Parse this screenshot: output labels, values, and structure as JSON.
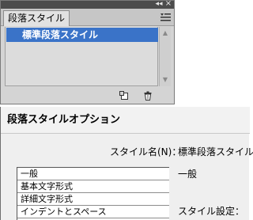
{
  "panel": {
    "tab_label": "段落スタイル",
    "selected_style": "標準段落スタイル"
  },
  "dialog": {
    "title": "段落スタイルオプション",
    "style_name_label": "スタイル名(N)：",
    "style_name_value": "標準段落スタイル",
    "section_heading": "一般",
    "settings_label": "スタイル設定：",
    "categories": [
      {
        "label": "一般"
      },
      {
        "label": "基本文字形式"
      },
      {
        "label": "詳細文字形式"
      },
      {
        "label": "インデントとスペース"
      }
    ]
  },
  "icons": {
    "collapse": "double-chevron-left-icon",
    "close": "close-icon",
    "panel_menu": "panel-menu-icon",
    "scroll_up": "scroll-up-arrow-icon",
    "scroll_down": "scroll-down-arrow-icon",
    "new_style": "new-style-icon",
    "delete_style": "trash-icon"
  },
  "colors": {
    "selection": "#3a73c8",
    "panel_titlebar": "#4c4c4c",
    "panel_bg": "#d4d4d4"
  }
}
